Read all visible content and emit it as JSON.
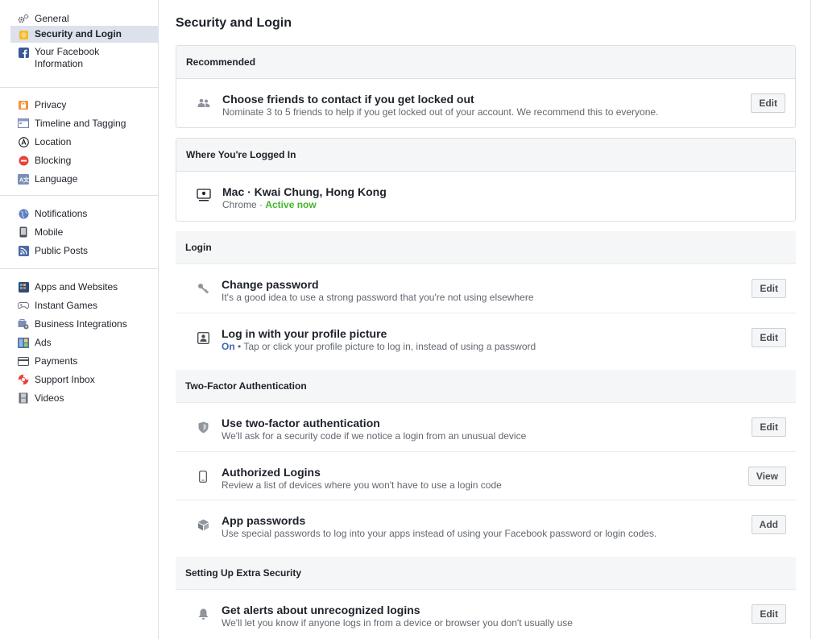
{
  "sidebar": {
    "groups": [
      [
        {
          "label": "General",
          "icon": "gears-icon"
        },
        {
          "label": "Security and Login",
          "icon": "shield-badge-icon",
          "active": true
        },
        {
          "label": "Your Facebook Information",
          "label_line2": "Information",
          "icon": "facebook-icon"
        }
      ],
      [
        {
          "label": "Privacy",
          "icon": "lock-icon"
        },
        {
          "label": "Timeline and Tagging",
          "icon": "timeline-icon"
        },
        {
          "label": "Location",
          "icon": "location-icon"
        },
        {
          "label": "Blocking",
          "icon": "block-icon"
        },
        {
          "label": "Language",
          "icon": "language-icon"
        }
      ],
      [
        {
          "label": "Notifications",
          "icon": "globe-icon"
        },
        {
          "label": "Mobile",
          "icon": "mobile-icon"
        },
        {
          "label": "Public Posts",
          "icon": "rss-icon"
        }
      ],
      [
        {
          "label": "Apps and Websites",
          "icon": "apps-icon"
        },
        {
          "label": "Instant Games",
          "icon": "gamepad-icon"
        },
        {
          "label": "Business Integrations",
          "icon": "business-icon"
        },
        {
          "label": "Ads",
          "icon": "ads-icon"
        },
        {
          "label": "Payments",
          "icon": "card-icon"
        },
        {
          "label": "Support Inbox",
          "icon": "lifebuoy-icon"
        },
        {
          "label": "Videos",
          "icon": "film-icon"
        }
      ]
    ]
  },
  "page": {
    "title": "Security and Login"
  },
  "sections": {
    "recommended": {
      "header": "Recommended",
      "rows": [
        {
          "title": "Choose friends to contact if you get locked out",
          "desc": "Nominate 3 to 5 friends to help if you get locked out of your account. We recommend this to everyone.",
          "button": "Edit",
          "icon": "friends-icon"
        }
      ]
    },
    "where_logged_in": {
      "header": "Where You're Logged In",
      "rows": [
        {
          "title": "Mac · Kwai Chung, Hong Kong",
          "desc_prefix": "Chrome · ",
          "desc_status": "Active now",
          "icon": "computer-icon"
        }
      ]
    },
    "login": {
      "header": "Login",
      "rows": [
        {
          "title": "Change password",
          "desc": "It's a good idea to use a strong password that you're not using elsewhere",
          "button": "Edit",
          "icon": "key-icon"
        },
        {
          "title": "Log in with your profile picture",
          "desc_on": "On",
          "desc": " • Tap or click your profile picture to log in, instead of using a password",
          "button": "Edit",
          "icon": "profile-picture-icon"
        }
      ]
    },
    "two_factor": {
      "header": "Two-Factor Authentication",
      "rows": [
        {
          "title": "Use two-factor authentication",
          "desc": "We'll ask for a security code if we notice a login from an unusual device",
          "button": "Edit",
          "icon": "shield-icon"
        },
        {
          "title": "Authorized Logins",
          "desc": "Review a list of devices where you won't have to use a login code",
          "button": "View",
          "icon": "phone-icon"
        },
        {
          "title": "App passwords",
          "desc": "Use special passwords to log into your apps instead of using your Facebook password or login codes.",
          "button": "Add",
          "icon": "cube-icon"
        }
      ]
    },
    "extra_security": {
      "header": "Setting Up Extra Security",
      "rows": [
        {
          "title": "Get alerts about unrecognized logins",
          "desc": "We'll let you know if anyone logs in from a device or browser you don't usually use",
          "button": "Edit",
          "icon": "bell-icon"
        }
      ]
    }
  },
  "colors": {
    "accent": "#4267b2",
    "active_green": "#42b72a",
    "sidebar_active": "#dce1eb"
  }
}
